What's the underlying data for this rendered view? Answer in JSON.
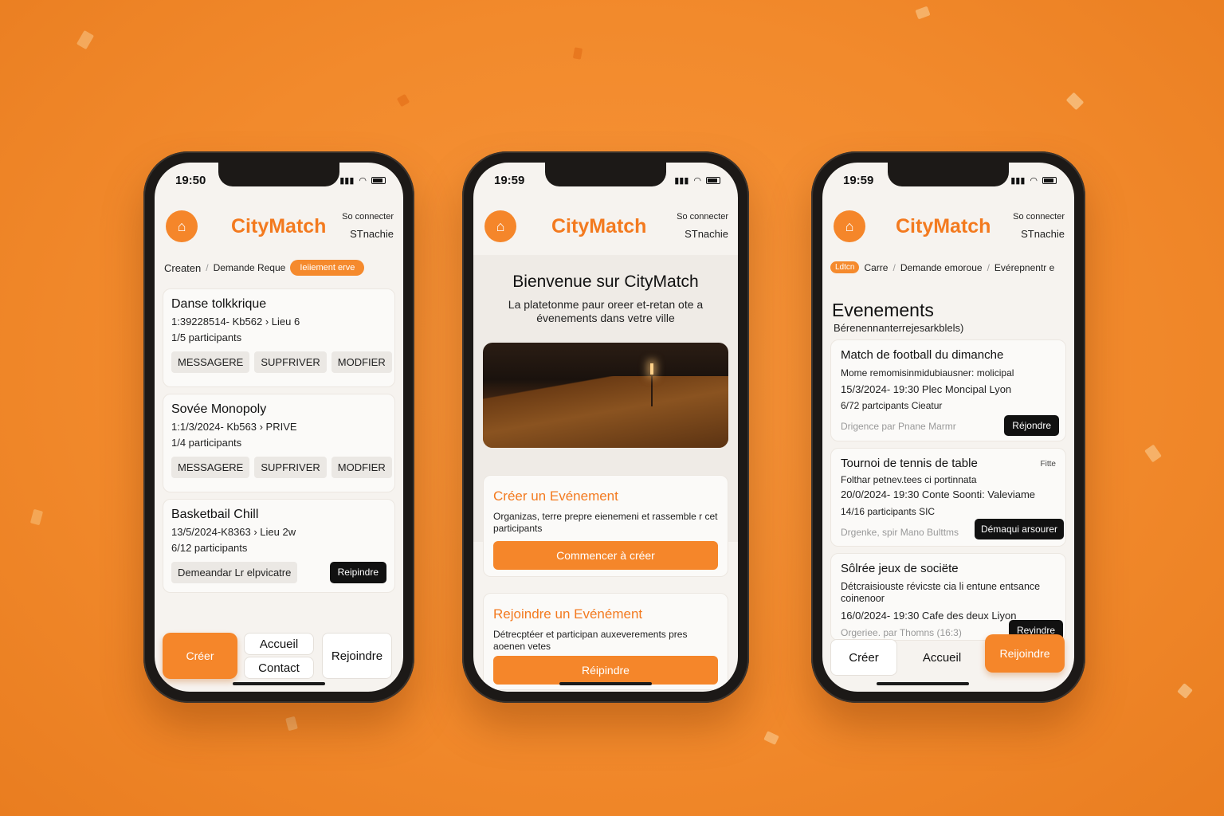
{
  "brand": {
    "accent": "#f5862a",
    "dark": "#111111"
  },
  "phone1": {
    "time": "19:50",
    "header": {
      "app_name": "CityMatch",
      "connect_label": "So connecter",
      "user_label": "STnachie",
      "logo_icon": "city-badge-icon"
    },
    "breadcrumb": {
      "item1": "Createn",
      "item2": "Demande Reque",
      "pill": "Ieiiement erve"
    },
    "events": [
      {
        "title": "Danse tolkkrique",
        "meta": "1:39228514- Kb562 › Lieu 6",
        "participants": "1/5 participants",
        "actions": [
          "MESSAGERE",
          "SUPFRIVER",
          "MODFIER"
        ]
      },
      {
        "title": "Sovée Monopoly",
        "meta": "1:1/3/2024- Kb563 › PRIVE",
        "participants": "1/4 participants",
        "actions": [
          "MESSAGERE",
          "SUPFRIVER",
          "MODFIER"
        ]
      },
      {
        "title": "Basketbail Chill",
        "meta": "13/5/2024-K8363 › Lieu 2w",
        "participants": "6/12 participants",
        "request_label": "Demeandar Lr elpvicatre",
        "join_label": "Reipindre"
      }
    ],
    "nav": {
      "create": "Créer",
      "home": "Accueil",
      "contact": "Contact",
      "join": "Rejoindre"
    }
  },
  "phone2": {
    "time": "19:59",
    "header": {
      "app_name": "CityMatch",
      "connect_label": "So connecter",
      "user_label": "STnachie",
      "logo_icon": "city-badge-icon"
    },
    "welcome": {
      "title": "Bienvenue sur CityMatch",
      "subtitle": "La platetonme paur oreer et-retan ote a évenements dans vetre ville"
    },
    "create": {
      "title": "Créer un Evénement",
      "desc": "Organizas, terre prepre eienemeni et rassemble r cet participants",
      "button": "Commencer à créer"
    },
    "join": {
      "title": "Rejoindre un Evénément",
      "desc": "Détrecptéer et participan auxeverements pres aoenen vetes",
      "button": "Réipindre"
    }
  },
  "phone3": {
    "time": "19:59",
    "header": {
      "app_name": "CityMatch",
      "connect_label": "So connecter",
      "user_label": "STnachie",
      "logo_icon": "city-badge-icon"
    },
    "breadcrumb": {
      "tag": "Ldtcn",
      "item1": "Carre",
      "item2": "Demande emoroue",
      "item3": "Evérepnentr e"
    },
    "title": "Evenements",
    "subtitle": "Bérenennanterrejesarkblels)",
    "events": [
      {
        "title": "Match de football du dimanche",
        "desc": "Mome remomisinmidubiausner: molicipal",
        "datetime": "15/3/2024- 19:30  Plec Moncipal Lyon",
        "participants": "6/72 partcipants   Cieatur",
        "organizer": "Drigence par Pnane Marmr",
        "button": "Réjondre"
      },
      {
        "title": "Tournoi de tennis de table",
        "tag": "Fitte",
        "desc": "Folthar petnev.tees ci portinnata",
        "datetime": "20/0/2024- 19:30  Conte Soonti: Valeviame",
        "participants": "14/16 participants   SIC",
        "organizer": "Drgenke, spir Mano Bulttms",
        "button": "Démaqui arsourer"
      },
      {
        "title": "Sôlrée jeux de sociëte",
        "desc": "Détcraisiouste révicste cia li entune entsance coinenoor",
        "datetime": "16/0/2024- 19:30  Cafe des deux Liyon",
        "organizer": "Orgeriee. par Thomns (16:3)",
        "button": "Reyindre"
      }
    ],
    "nav": {
      "create": "Créer",
      "home": "Accueil",
      "join": "Reijoindre"
    }
  }
}
